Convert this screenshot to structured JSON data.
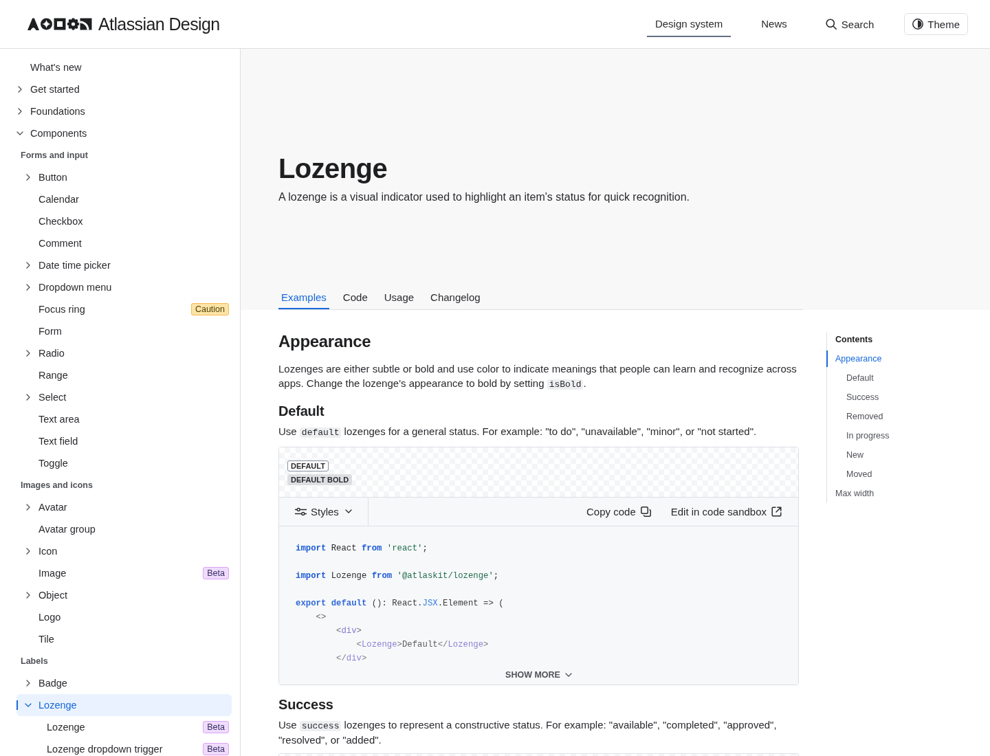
{
  "header": {
    "brand": "Atlassian Design",
    "nav": [
      {
        "label": "Design system",
        "selected": true
      },
      {
        "label": "News",
        "selected": false
      }
    ],
    "search": {
      "label": "Search"
    },
    "theme": {
      "label": "Theme"
    }
  },
  "sidebar": {
    "items": [
      {
        "kind": "page",
        "label": "What's new",
        "selected": false
      },
      {
        "kind": "folder",
        "label": "Get started",
        "expanded": false,
        "selected": false
      },
      {
        "kind": "folder",
        "label": "Foundations",
        "expanded": false,
        "selected": false
      },
      {
        "kind": "folder",
        "label": "Components",
        "expanded": true,
        "selected": false,
        "children": [
          {
            "kind": "heading",
            "label": "Forms and input"
          },
          {
            "kind": "folder",
            "label": "Button",
            "expanded": false,
            "selected": false
          },
          {
            "kind": "page",
            "label": "Calendar",
            "selected": false
          },
          {
            "kind": "page",
            "label": "Checkbox",
            "selected": false
          },
          {
            "kind": "page",
            "label": "Comment",
            "selected": false
          },
          {
            "kind": "folder",
            "label": "Date time picker",
            "expanded": false,
            "selected": false
          },
          {
            "kind": "folder",
            "label": "Dropdown menu",
            "expanded": false,
            "selected": false
          },
          {
            "kind": "page",
            "label": "Focus ring",
            "selected": false,
            "badge": {
              "label": "Caution",
              "kind": "caution"
            }
          },
          {
            "kind": "page",
            "label": "Form",
            "selected": false
          },
          {
            "kind": "folder",
            "label": "Radio",
            "expanded": false,
            "selected": false
          },
          {
            "kind": "page",
            "label": "Range",
            "selected": false
          },
          {
            "kind": "folder",
            "label": "Select",
            "expanded": false,
            "selected": false
          },
          {
            "kind": "page",
            "label": "Text area",
            "selected": false
          },
          {
            "kind": "page",
            "label": "Text field",
            "selected": false
          },
          {
            "kind": "page",
            "label": "Toggle",
            "selected": false
          },
          {
            "kind": "heading",
            "label": "Images and icons"
          },
          {
            "kind": "folder",
            "label": "Avatar",
            "expanded": false,
            "selected": false
          },
          {
            "kind": "page",
            "label": "Avatar group",
            "selected": false
          },
          {
            "kind": "folder",
            "label": "Icon",
            "expanded": false,
            "selected": false
          },
          {
            "kind": "page",
            "label": "Image",
            "selected": false,
            "badge": {
              "label": "Beta",
              "kind": "beta"
            }
          },
          {
            "kind": "folder",
            "label": "Object",
            "expanded": false,
            "selected": false
          },
          {
            "kind": "page",
            "label": "Logo",
            "selected": false
          },
          {
            "kind": "page",
            "label": "Tile",
            "selected": false
          },
          {
            "kind": "heading",
            "label": "Labels"
          },
          {
            "kind": "folder",
            "label": "Badge",
            "expanded": false,
            "selected": false
          },
          {
            "kind": "folder",
            "label": "Lozenge",
            "expanded": true,
            "selected": true,
            "children": [
              {
                "kind": "page",
                "label": "Lozenge",
                "selected": false,
                "badge": {
                  "label": "Beta",
                  "kind": "beta"
                }
              },
              {
                "kind": "page",
                "label": "Lozenge dropdown trigger",
                "selected": false,
                "badge": {
                  "label": "Beta",
                  "kind": "beta"
                }
              }
            ]
          }
        ]
      }
    ]
  },
  "page": {
    "title": "Lozenge",
    "description": "A lozenge is a visual indicator used to highlight an item's status for quick recognition.",
    "tabs": [
      {
        "label": "Examples",
        "selected": true
      },
      {
        "label": "Code",
        "selected": false
      },
      {
        "label": "Usage",
        "selected": false
      },
      {
        "label": "Changelog",
        "selected": false
      }
    ]
  },
  "content": {
    "blocks": [
      {
        "kind": "heading2",
        "text": "Appearance"
      },
      {
        "kind": "paragraph",
        "parts": [
          {
            "kind": "text",
            "text": "Lozenges are either subtle or bold and use color to indicate meanings that people can learn and recognize across apps. Change the lozenge's appearance to bold by setting "
          },
          {
            "kind": "code",
            "text": "isBold"
          },
          {
            "kind": "text",
            "text": "."
          }
        ]
      },
      {
        "kind": "heading3",
        "text": "Default"
      },
      {
        "kind": "paragraph",
        "parts": [
          {
            "kind": "text",
            "text": "Use "
          },
          {
            "kind": "code",
            "text": "default"
          },
          {
            "kind": "text",
            "text": " lozenges for a general status. For example: \"to do\", \"unavailable\", \"minor\", or \"not started\"."
          }
        ]
      },
      {
        "kind": "example",
        "lozenges": [
          {
            "label": "DEFAULT",
            "bold": false
          },
          {
            "label": "DEFAULT BOLD",
            "bold": true
          }
        ],
        "styles": "Styles",
        "copy": "Copy code",
        "sandbox": "Edit in code sandbox",
        "code": [
          [
            [
              {
                "kind": "keyword",
                "text": "import"
              },
              {
                "kind": "plain",
                "text": " React "
              },
              {
                "kind": "keyword",
                "text": "from"
              },
              {
                "kind": "string",
                "text": " 'react'"
              },
              {
                "kind": "plain",
                "text": ";"
              }
            ]
          ],
          [
            [
              {
                "kind": "keyword",
                "text": "import"
              },
              {
                "kind": "plain",
                "text": " Lozenge "
              },
              {
                "kind": "keyword",
                "text": "from"
              },
              {
                "kind": "string",
                "text": " '@atlaskit/lozenge'"
              },
              {
                "kind": "plain",
                "text": ";"
              }
            ]
          ],
          [
            [
              {
                "kind": "keyword",
                "text": "export default"
              },
              {
                "kind": "plain",
                "text": " (): React."
              },
              {
                "kind": "type",
                "text": "JSX"
              },
              {
                "kind": "plain",
                "text": ".Element => ("
              }
            ],
            [
              {
                "kind": "punct",
                "text": "    <>"
              }
            ],
            [
              {
                "kind": "punct",
                "text": "        <"
              },
              {
                "kind": "tag",
                "text": "div"
              },
              {
                "kind": "punct",
                "text": ">"
              }
            ],
            [
              {
                "kind": "punct",
                "text": "            <"
              },
              {
                "kind": "tag",
                "text": "Lozenge"
              },
              {
                "kind": "punct",
                "text": ">"
              },
              {
                "kind": "plain",
                "text": "Default"
              },
              {
                "kind": "punct",
                "text": "</"
              },
              {
                "kind": "tag",
                "text": "Lozenge"
              },
              {
                "kind": "punct",
                "text": ">"
              }
            ],
            [
              {
                "kind": "punct",
                "text": "        </"
              },
              {
                "kind": "tag",
                "text": "div"
              },
              {
                "kind": "punct",
                "text": ">"
              }
            ]
          ]
        ],
        "show_more": "SHOW MORE"
      },
      {
        "kind": "heading3",
        "text": "Success"
      },
      {
        "kind": "paragraph",
        "parts": [
          {
            "kind": "text",
            "text": "Use "
          },
          {
            "kind": "code",
            "text": "success"
          },
          {
            "kind": "text",
            "text": " lozenges to represent a constructive status. For example: \"available\", \"completed\", \"approved\", \"resolved\", or \"added\"."
          }
        ]
      },
      {
        "kind": "example_preview"
      }
    ]
  },
  "contents": {
    "title": "Contents",
    "items": [
      {
        "label": "Appearance",
        "selected": true,
        "children": [
          {
            "label": "Default",
            "selected": false
          },
          {
            "label": "Success",
            "selected": false
          },
          {
            "label": "Removed",
            "selected": false
          },
          {
            "label": "In progress",
            "selected": false
          },
          {
            "label": "New",
            "selected": false
          },
          {
            "label": "Moved",
            "selected": false
          }
        ]
      },
      {
        "label": "Max width",
        "selected": false
      }
    ]
  }
}
